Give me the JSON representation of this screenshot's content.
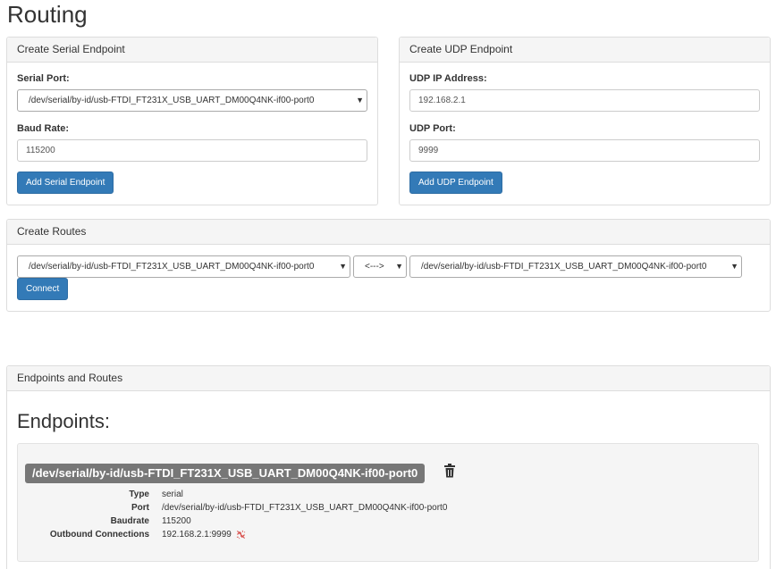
{
  "page": {
    "title": "Routing"
  },
  "serial_panel": {
    "heading": "Create Serial Endpoint",
    "port_label": "Serial Port:",
    "port_value": "/dev/serial/by-id/usb-FTDI_FT231X_USB_UART_DM00Q4NK-if00-port0",
    "baud_label": "Baud Rate:",
    "baud_value": "115200",
    "add_button": "Add Serial Endpoint"
  },
  "udp_panel": {
    "heading": "Create UDP Endpoint",
    "ip_label": "UDP IP Address:",
    "ip_value": "192.168.2.1",
    "port_label": "UDP Port:",
    "port_value": "9999",
    "add_button": "Add UDP Endpoint"
  },
  "routes_panel": {
    "heading": "Create Routes",
    "source_value": "/dev/serial/by-id/usb-FTDI_FT231X_USB_UART_DM00Q4NK-if00-port0",
    "direction_value": "<--->",
    "target_value": "/dev/serial/by-id/usb-FTDI_FT231X_USB_UART_DM00Q4NK-if00-port0",
    "connect_button": "Connect"
  },
  "endpoints_panel": {
    "heading": "Endpoints and Routes",
    "section_title": "Endpoints:",
    "endpoint": {
      "label": "/dev/serial/by-id/usb-FTDI_FT231X_USB_UART_DM00Q4NK-if00-port0",
      "delete_icon": "trash-icon",
      "type_key": "Type",
      "type_value": "serial",
      "port_key": "Port",
      "port_value": "/dev/serial/by-id/usb-FTDI_FT231X_USB_UART_DM00Q4NK-if00-port0",
      "baud_key": "Baudrate",
      "baud_value": "115200",
      "outbound_key": "Outbound Connections",
      "outbound_value": "192.168.2.1:9999",
      "outbound_icon": "unlink-icon"
    }
  },
  "colors": {
    "primary_button": "#337ab7",
    "label_badge": "#777777",
    "panel_heading": "#f5f5f5",
    "unlink_icon": "#d9534f"
  }
}
